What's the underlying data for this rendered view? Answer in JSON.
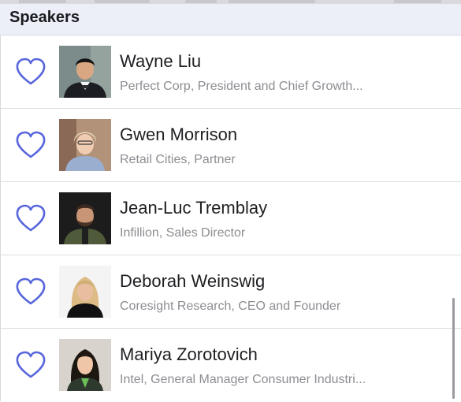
{
  "section": {
    "title": "Speakers"
  },
  "speakers": [
    {
      "name": "Wayne Liu",
      "subtitle": "Perfect Corp, President and Chief Growth...",
      "favorite_icon": "heart-outline-icon"
    },
    {
      "name": "Gwen Morrison",
      "subtitle": "Retail Cities, Partner",
      "favorite_icon": "heart-outline-icon"
    },
    {
      "name": "Jean-Luc Tremblay",
      "subtitle": "Infillion, Sales Director",
      "favorite_icon": "heart-outline-icon"
    },
    {
      "name": "Deborah Weinswig",
      "subtitle": "Coresight Research, CEO and Founder",
      "favorite_icon": "heart-outline-icon"
    },
    {
      "name": "Mariya Zorotovich",
      "subtitle": "Intel, General Manager Consumer Industri...",
      "favorite_icon": "heart-outline-icon"
    }
  ],
  "colors": {
    "accent": "#5866dc",
    "header_bg": "#eceef8",
    "name_text": "#1f1f23",
    "subtitle_text": "#8d8d93"
  }
}
